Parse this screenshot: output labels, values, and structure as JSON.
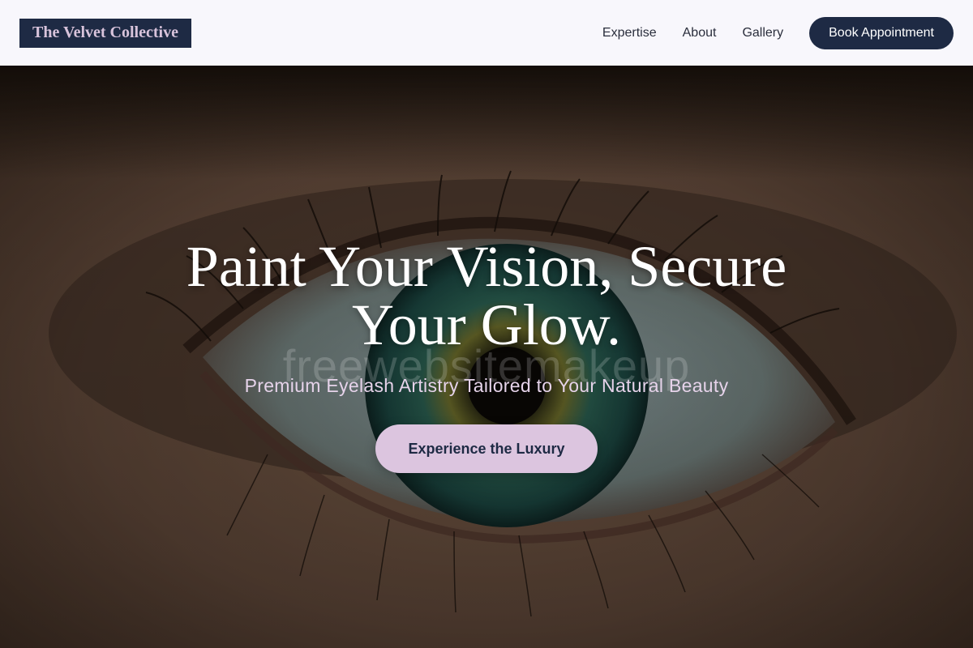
{
  "header": {
    "logo": "The Velvet Collective",
    "nav": [
      {
        "label": "Expertise"
      },
      {
        "label": "About"
      },
      {
        "label": "Gallery"
      }
    ],
    "cta_label": "Book Appointment"
  },
  "hero": {
    "title": "Paint Your Vision, Secure Your Glow.",
    "watermark": "freewebsitemakeup",
    "subtitle": "Premium Eyelash Artistry Tailored to Your Natural Beauty",
    "cta_label": "Experience the Luxury"
  },
  "colors": {
    "navy": "#1e2a44",
    "lavender": "#dcc5df",
    "header_bg": "#f8f7fc"
  }
}
